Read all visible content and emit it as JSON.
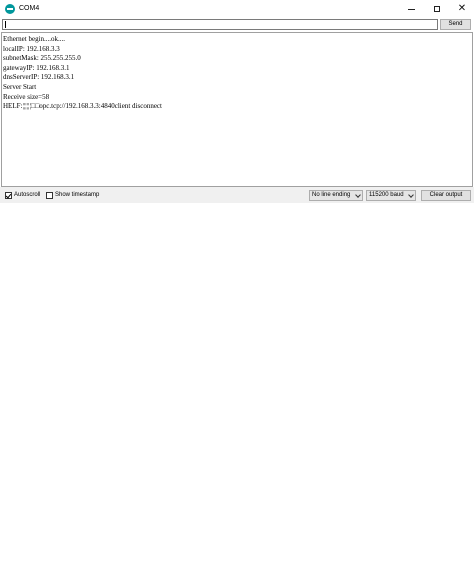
{
  "window": {
    "title": "COM4",
    "accent_color": "#00979c"
  },
  "input": {
    "value": "",
    "send_label": "Send"
  },
  "output": {
    "lines": [
      "Ethernet begin....ok....",
      "localIP: 192.168.3.3",
      "subnetMask: 255.255.255.0",
      "gatewayIP: 192.168.3.1",
      "dnsServerIP: 192.168.3.1",
      "Server Start",
      "Receive size=58",
      "HELF:¦¦¦¦¦¦□□opc.tcp://192.168.3.3:4840client disconnect"
    ]
  },
  "bottom_bar": {
    "autoscroll_label": "Autoscroll",
    "autoscroll_checked": true,
    "timestamp_label": "Show timestamp",
    "timestamp_checked": false,
    "line_ending_selected": "No line ending",
    "baud_selected": "115200 baud",
    "clear_label": "Clear output"
  },
  "icons": {
    "app": "arduino-icon",
    "minimize": "minimize-icon",
    "maximize": "maximize-icon",
    "close": "close-icon"
  }
}
